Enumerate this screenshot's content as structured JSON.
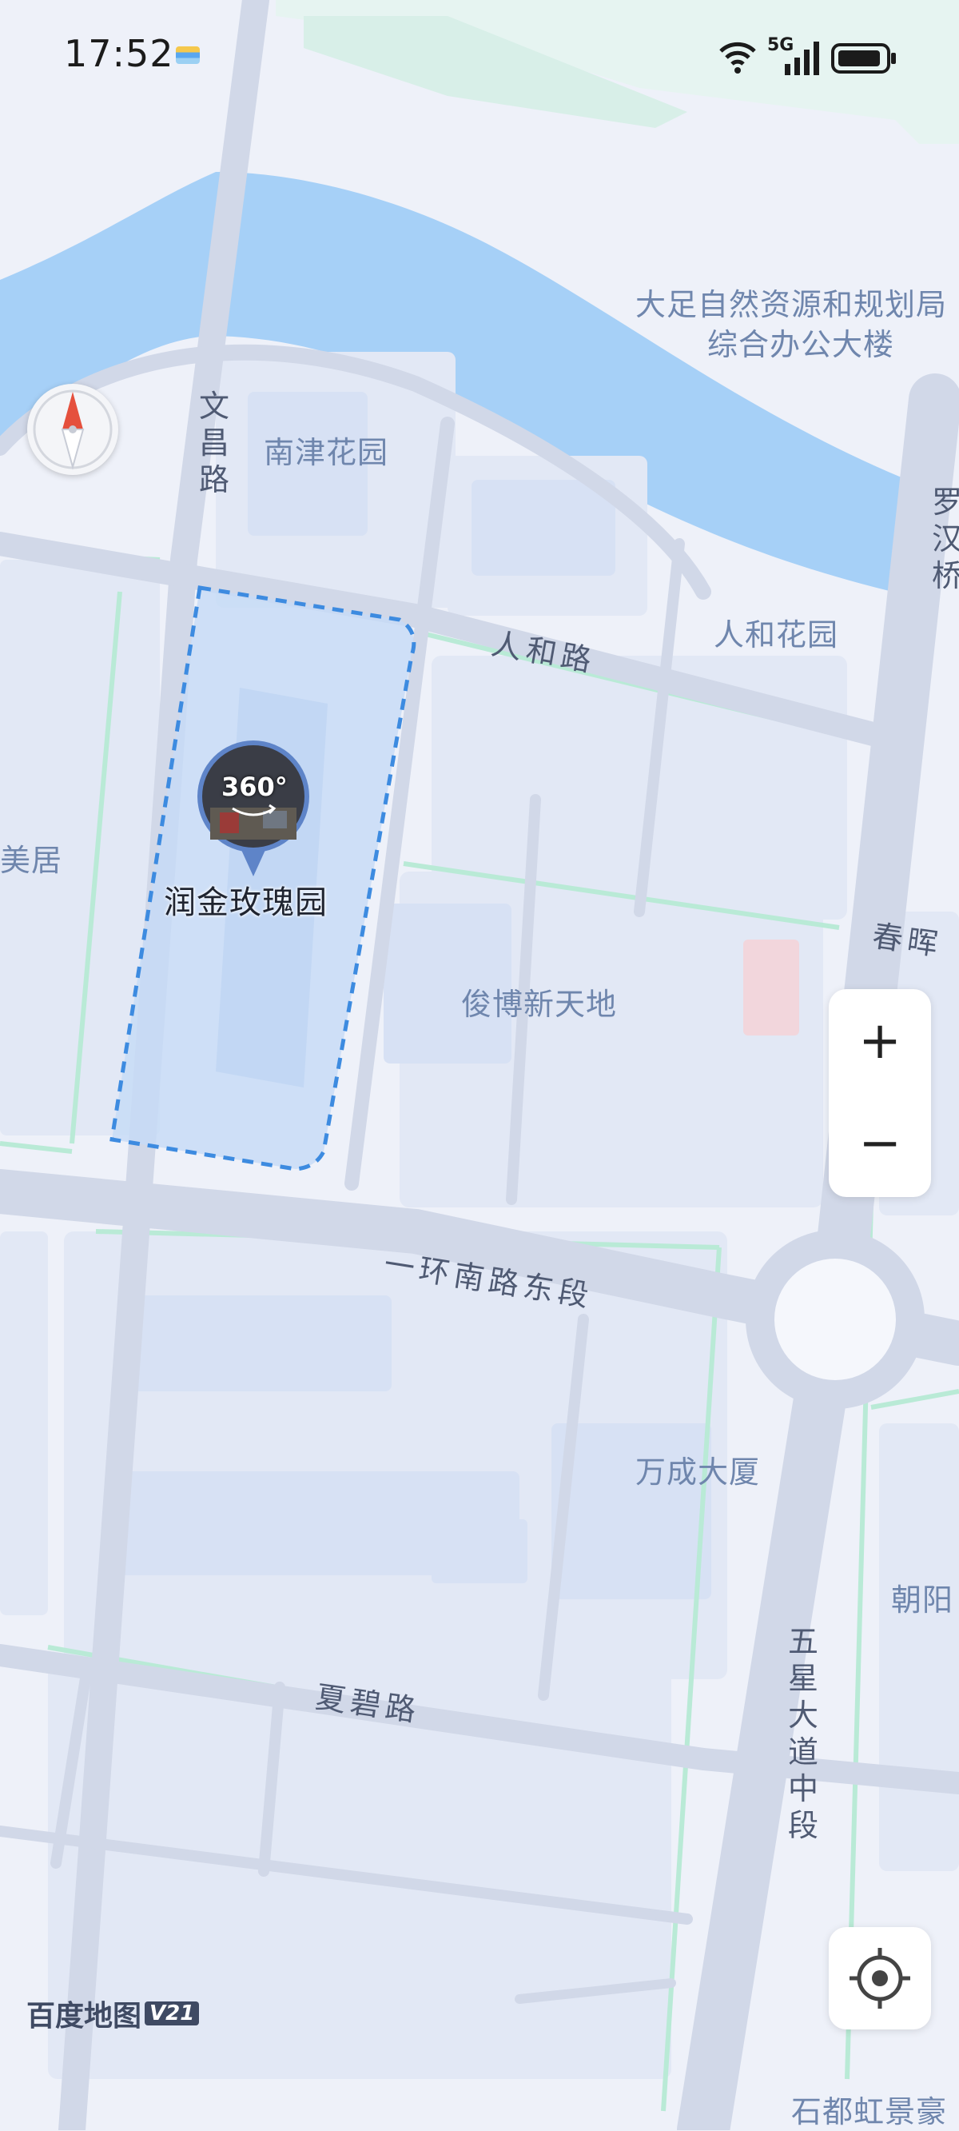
{
  "status_bar": {
    "time": "17:52",
    "network": "5G"
  },
  "map": {
    "places": [
      {
        "id": "dazu",
        "text": "大足自然资源和规划局"
      },
      {
        "id": "dazu2",
        "text": "综合办公大楼"
      },
      {
        "id": "nanjin",
        "text": "南津花园"
      },
      {
        "id": "renhe_garden",
        "text": "人和花园"
      },
      {
        "id": "meiju",
        "text": "美居"
      },
      {
        "id": "junbo",
        "text": "俊博新天地"
      },
      {
        "id": "wancheng",
        "text": "万成大厦"
      },
      {
        "id": "chaoyang",
        "text": "朝阳"
      },
      {
        "id": "shidu",
        "text": "石都虹景豪"
      }
    ],
    "roads": [
      {
        "id": "renhe_road",
        "text": "人和路"
      },
      {
        "id": "yihuan",
        "text": "一环南路东段"
      },
      {
        "id": "xiabi",
        "text": "夏碧路"
      },
      {
        "id": "chunhui",
        "text": "春晖"
      }
    ],
    "vertical_roads": [
      {
        "id": "wenchang",
        "text": "文昌路"
      },
      {
        "id": "wuxing",
        "text": "五星大道中段"
      },
      {
        "id": "luohan",
        "text": "罗汉桥"
      }
    ],
    "poi": {
      "name": "润金玫瑰园",
      "badge": "360°"
    }
  },
  "controls": {
    "zoom_in": "+",
    "zoom_out": "−"
  },
  "brand": {
    "name": "百度地图",
    "version": "V21"
  },
  "colors": {
    "water": "#a6d0f7",
    "road": "#d1d8e8",
    "green_edge": "#b9ead6",
    "block": "#e4eaf6",
    "highlight": "#3d8be0"
  }
}
